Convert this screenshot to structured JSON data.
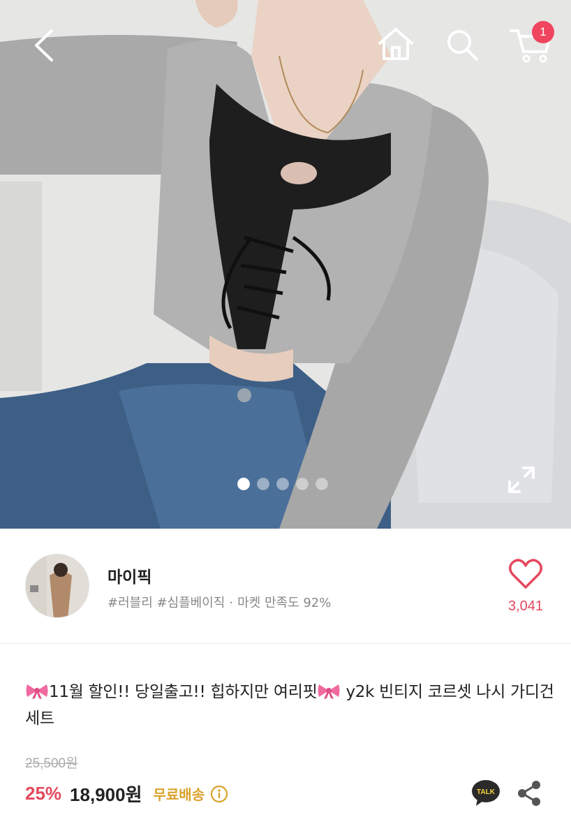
{
  "header": {
    "back_icon": "chevron-left-icon",
    "home_icon": "home-icon",
    "search_icon": "search-icon",
    "cart_icon": "cart-icon",
    "cart_count": "1"
  },
  "gallery": {
    "image_count": 5,
    "active_index": 0,
    "expand_icon": "expand-icon"
  },
  "shop": {
    "name": "마이픽",
    "tags": "#러블리 #심플베이직",
    "separator": "·",
    "satisfaction": "마켓 만족도 92%",
    "like_icon": "heart-icon",
    "like_count": "3,041"
  },
  "product": {
    "title_part1": "11월 할인!! 당일출고!! 힙하지만 여리핏",
    "title_part2": " y2k 빈티지 코르셋 나시 가디건 세트",
    "original_price": "25,500원",
    "discount": "25%",
    "price": "18,900원",
    "shipping": "무료배송",
    "info_icon": "info-icon",
    "talk_label": "TALK",
    "share_icon": "share-icon"
  },
  "colors": {
    "accent": "#e5485e",
    "badge": "#f0455f",
    "shipping": "#d9a12a"
  }
}
